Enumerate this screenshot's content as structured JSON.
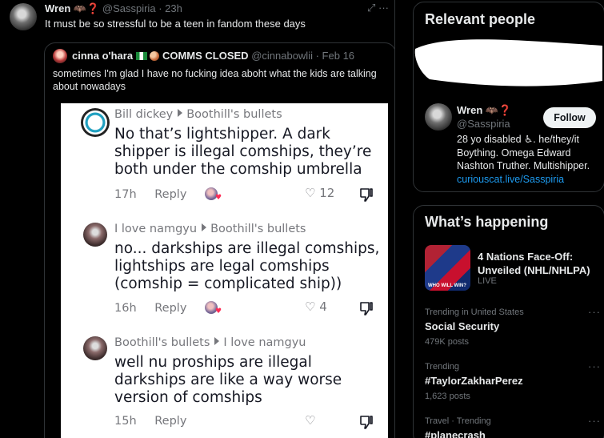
{
  "post": {
    "author": "Wren",
    "author_emoji": "🦇❓",
    "handle": "@Sasspiria",
    "time": "· 23h",
    "text": "It must be so stressful to be a teen in fandom these days",
    "actions": "⤢ ···"
  },
  "quote": {
    "author": "cinna o'hara",
    "status": "COMMS CLOSED",
    "handle": "@cinnabowlii",
    "date": "· Feb 16",
    "text": "sometimes I'm glad I have no fucking idea aboht what the kids are talking about nowadays"
  },
  "comments": [
    {
      "user": "Bill dickey",
      "reply_to": "Boothill's bullets",
      "body": "No that’s lightshipper. A dark shipper is illegal comships, they’re both under the comship umbrella",
      "age": "17h",
      "reply": "Reply",
      "likes": "12"
    },
    {
      "user": "I love namgyu",
      "reply_to": "Boothill's bullets",
      "body": "no... darkships are illegal comships, lightships are legal comships (comship = complicated ship))",
      "age": "16h",
      "reply": "Reply",
      "likes": "4"
    },
    {
      "user": "Boothill's bullets",
      "reply_to": "I love namgyu",
      "body": "well nu proships are illegal darkships are like a way worse version of comships",
      "age": "15h",
      "reply": "Reply",
      "likes": ""
    }
  ],
  "sidebar": {
    "relevant_title": "Relevant people",
    "person": {
      "name": "Wren",
      "emoji": "🦇❓",
      "handle": "@Sasspiria",
      "follow": "Follow",
      "bio": "28 yo disabled ♿. he/they/it Boything. Omega Edward Nashton Truther. Multishipper.",
      "link": "curiouscat.live/Sasspiria"
    },
    "happening_title": "What’s happening",
    "event": {
      "title": "4 Nations Face-Off: Unveiled (NHL/NHLPA)",
      "status": "LIVE",
      "image_text": "WHO WILL WIN?"
    },
    "trends": [
      {
        "category": "Trending in United States",
        "title": "Social Security",
        "count": "479K posts"
      },
      {
        "category": "Trending",
        "title": "#TaylorZakharPerez",
        "count": "1,623 posts"
      },
      {
        "category": "Travel · Trending",
        "title": "#planecrash",
        "count": ""
      }
    ],
    "more": "···"
  },
  "colors": {
    "background": "#000000",
    "text": "#e7e9ea",
    "muted": "#71767b",
    "link": "#1d9bf0",
    "border": "#2f3336",
    "like_heart": "#fe2c55"
  }
}
